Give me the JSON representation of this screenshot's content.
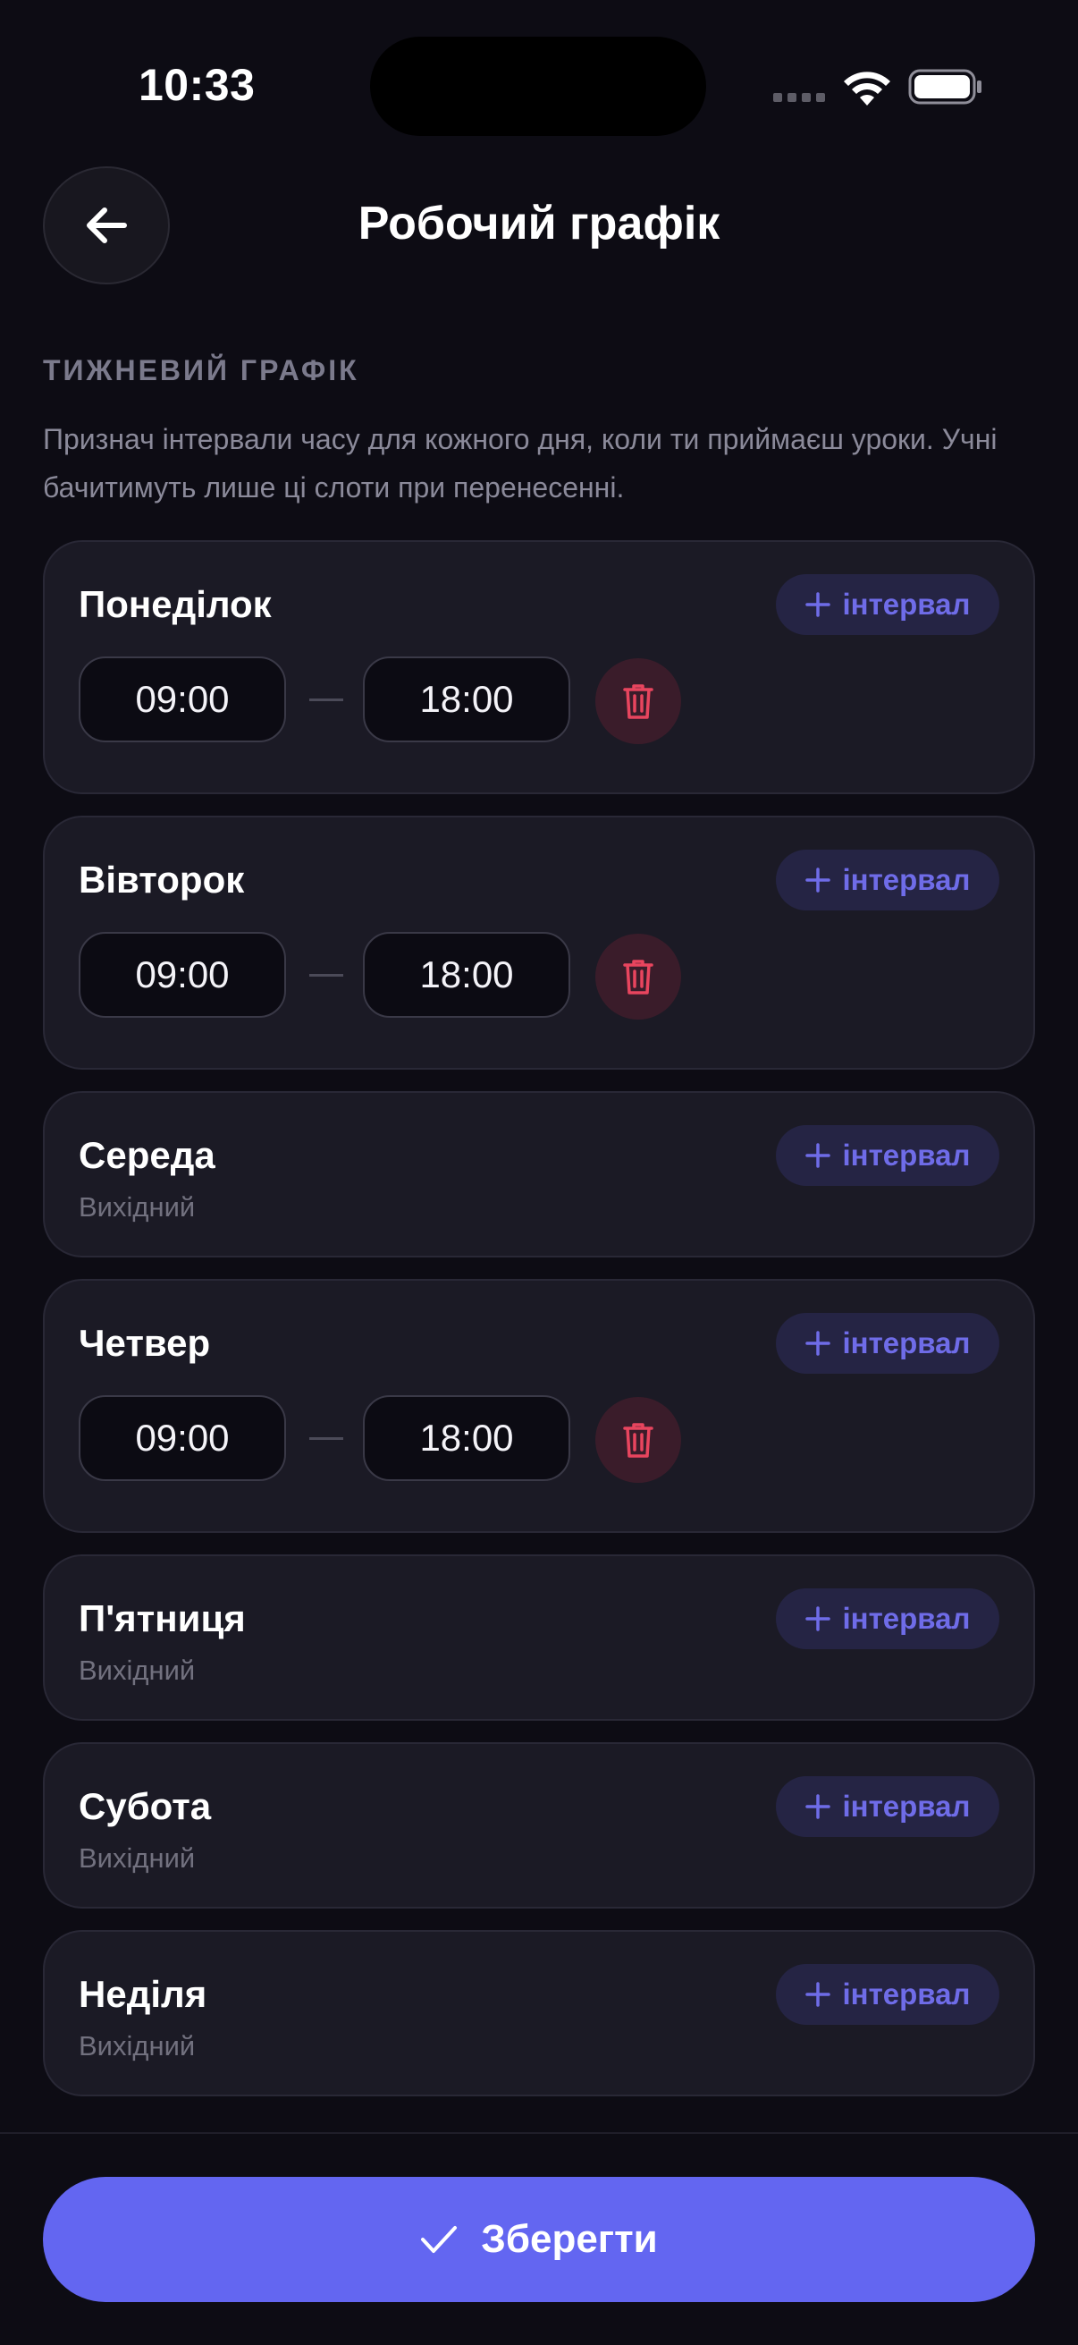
{
  "status_bar": {
    "time": "10:33"
  },
  "header": {
    "title": "Робочий графік"
  },
  "section": {
    "title": "ТИЖНЕВИЙ ГРАФІК",
    "description": "Признач інтервали часу для кожного дня, коли ти приймаєш уроки. Учні бачитимуть лише ці слоти при перенесенні."
  },
  "add_interval_label": "інтервал",
  "days": [
    {
      "name": "Понеділок",
      "intervals": [
        {
          "start": "09:00",
          "end": "18:00"
        }
      ]
    },
    {
      "name": "Вівторок",
      "intervals": [
        {
          "start": "09:00",
          "end": "18:00"
        }
      ]
    },
    {
      "name": "Середа",
      "status": "Вихідний"
    },
    {
      "name": "Четвер",
      "intervals": [
        {
          "start": "09:00",
          "end": "18:00"
        }
      ]
    },
    {
      "name": "П'ятниця",
      "status": "Вихідний"
    },
    {
      "name": "Субота",
      "status": "Вихідний"
    },
    {
      "name": "Неділя",
      "status": "Вихідний"
    }
  ],
  "footer": {
    "save_label": "Зберегти"
  },
  "colors": {
    "accent": "#6366f1",
    "background": "#0d0c14",
    "card": "#1b1a25",
    "delete": "#e8455e"
  }
}
